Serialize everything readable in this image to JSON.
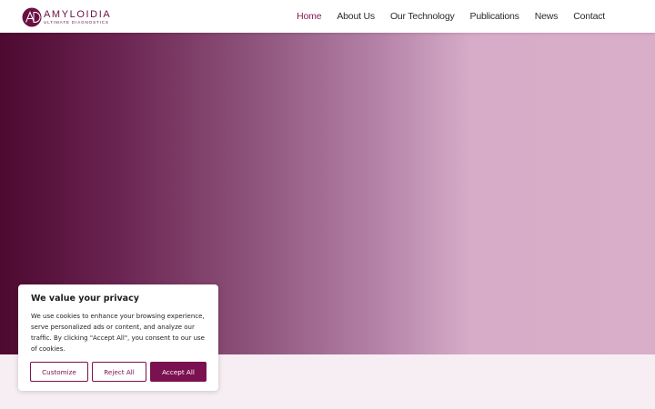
{
  "brand": {
    "name": "AMYLOIDIA",
    "tagline": "ULTIMATE DIAGNOSTICS",
    "logo_icon": "ad-monogram-icon",
    "color": "#6b0f43"
  },
  "nav": {
    "items": [
      {
        "label": "Home",
        "active": true
      },
      {
        "label": "About Us",
        "active": false
      },
      {
        "label": "Our Technology",
        "active": false
      },
      {
        "label": "Publications",
        "active": false
      },
      {
        "label": "News",
        "active": false
      },
      {
        "label": "Contact",
        "active": false
      }
    ],
    "active_color": "#8a1a5a"
  },
  "cookie_banner": {
    "title": "We value your privacy",
    "text": "We use cookies to enhance your browsing experience, serve personalized ads or content, and analyze our traffic. By clicking \"Accept All\", you consent to our use of cookies.",
    "buttons": {
      "customize": "Customize",
      "reject": "Reject All",
      "accept": "Accept All"
    },
    "accent_color": "#7b1150"
  }
}
